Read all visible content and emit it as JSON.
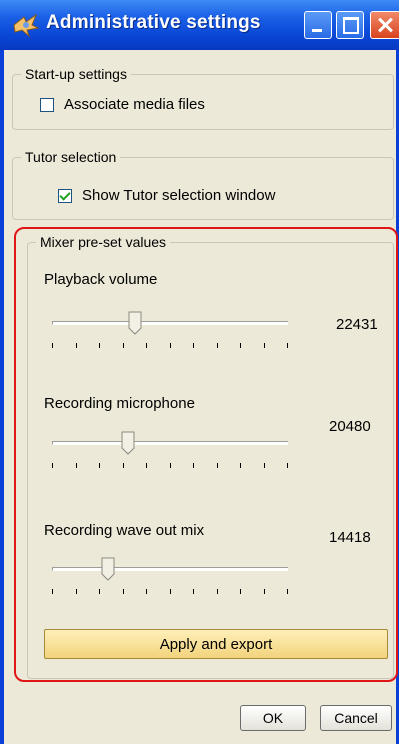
{
  "window": {
    "title": "Administrative settings",
    "icon": "app-icon"
  },
  "startup": {
    "legend": "Start-up settings",
    "associate_label": "Associate media files",
    "associate_checked": false
  },
  "tutor": {
    "legend": "Tutor selection",
    "show_label": "Show Tutor selection window",
    "show_checked": true
  },
  "mixer": {
    "legend": "Mixer pre-set values",
    "playback": {
      "label": "Playback volume",
      "value": "22431",
      "fraction": 0.342
    },
    "recording_mic": {
      "label": "Recording microphone",
      "value": "20480",
      "fraction": 0.3125
    },
    "recording_wave": {
      "label": "Recording wave out mix",
      "value": "14418",
      "fraction": 0.22
    },
    "apply_label": "Apply and export"
  },
  "buttons": {
    "ok_label": "OK",
    "cancel_label": "Cancel"
  },
  "colors": {
    "title_bar": "#0a47d6",
    "client_bg": "#ece9d8",
    "highlight": "#e01515",
    "apply_bg": "#f2d37d"
  }
}
